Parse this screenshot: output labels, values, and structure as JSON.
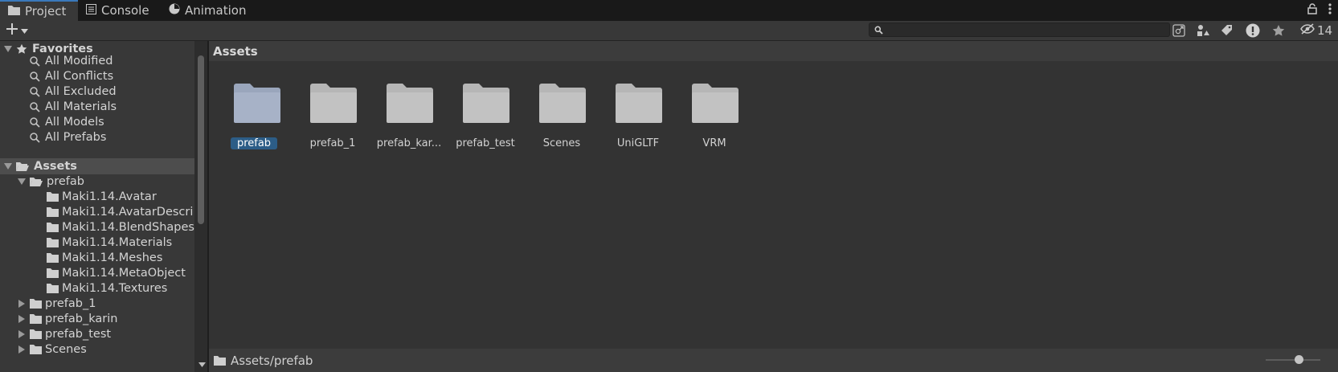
{
  "tabs": [
    {
      "label": "Project",
      "icon": "folder-icon",
      "active": true
    },
    {
      "label": "Console",
      "icon": "console-icon",
      "active": false
    },
    {
      "label": "Animation",
      "icon": "animation-icon",
      "active": false
    }
  ],
  "toolbar": {
    "search_value": "",
    "hidden_count": "14"
  },
  "tree": {
    "favorites_label": "Favorites",
    "favorites": [
      "All Modified",
      "All Conflicts",
      "All Excluded",
      "All Materials",
      "All Models",
      "All Prefabs"
    ],
    "assets_label": "Assets",
    "prefab_label": "prefab",
    "prefab_children": [
      "Maki1.14.Avatar",
      "Maki1.14.AvatarDescri",
      "Maki1.14.BlendShapes",
      "Maki1.14.Materials",
      "Maki1.14.Meshes",
      "Maki1.14.MetaObject",
      "Maki1.14.Textures"
    ],
    "siblings": [
      "prefab_1",
      "prefab_karin",
      "prefab_test",
      "Scenes"
    ]
  },
  "breadcrumb": "Assets",
  "assets": [
    {
      "label": "prefab",
      "selected": true
    },
    {
      "label": "prefab_1",
      "selected": false
    },
    {
      "label": "prefab_kar...",
      "selected": false
    },
    {
      "label": "prefab_test",
      "selected": false
    },
    {
      "label": "Scenes",
      "selected": false
    },
    {
      "label": "UniGLTF",
      "selected": false
    },
    {
      "label": "VRM",
      "selected": false
    }
  ],
  "status_path": "Assets/prefab",
  "thumbnail_zoom": 0.6,
  "colors": {
    "selection": "#2c5d87",
    "folder": "#c2c2c2",
    "folder_selected": "#9aa6bc",
    "tab_accent": "#3a79bb"
  }
}
